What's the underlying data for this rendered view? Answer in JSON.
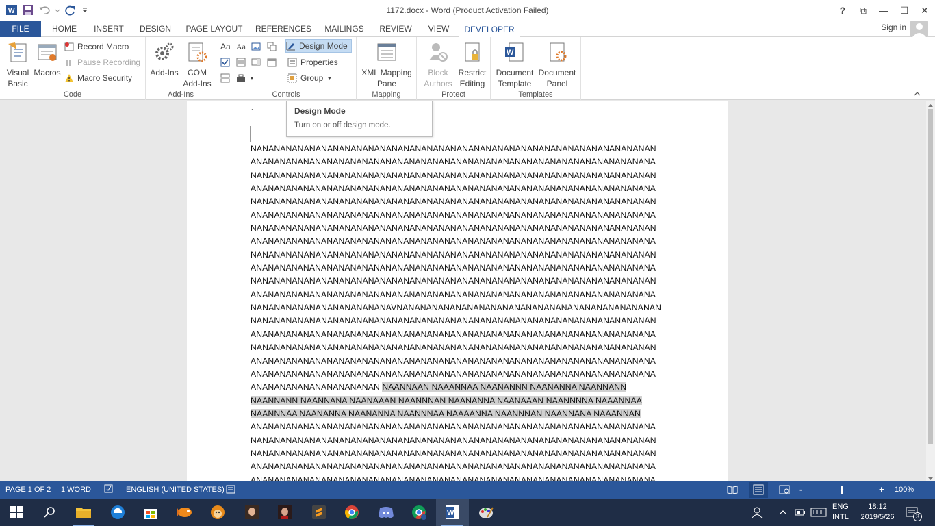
{
  "titlebar": {
    "title": "1172.docx - Word (Product Activation Failed)",
    "help": "?",
    "ribbon_display": "⧉",
    "minimize": "—",
    "maximize": "☐",
    "close": "✕"
  },
  "tabs": [
    "FILE",
    "HOME",
    "INSERT",
    "DESIGN",
    "PAGE LAYOUT",
    "REFERENCES",
    "MAILINGS",
    "REVIEW",
    "VIEW",
    "DEVELOPER"
  ],
  "active_tab": "DEVELOPER",
  "signin": "Sign in",
  "ribbon": {
    "code": {
      "label": "Code",
      "visual_basic": [
        "Visual",
        "Basic"
      ],
      "macros": "Macros",
      "record_macro": "Record Macro",
      "pause_recording": "Pause Recording",
      "macro_security": "Macro Security"
    },
    "addins": {
      "label": "Add-Ins",
      "addins": "Add-Ins",
      "com_addins": [
        "COM",
        "Add-Ins"
      ]
    },
    "controls": {
      "label": "Controls",
      "design_mode": "Design Mode",
      "properties": "Properties",
      "group": "Group",
      "aa1": "Aa",
      "aa2": "Aa"
    },
    "mapping": {
      "label": "Mapping",
      "xml_mapping": [
        "XML Mapping",
        "Pane"
      ]
    },
    "protect": {
      "label": "Protect",
      "block_authors": [
        "Block",
        "Authors"
      ],
      "restrict_editing": [
        "Restrict",
        "Editing"
      ]
    },
    "templates": {
      "label": "Templates",
      "document_template": [
        "Document",
        "Template"
      ],
      "document_panel": [
        "Document",
        "Panel"
      ]
    }
  },
  "tooltip": {
    "title": "Design Mode",
    "description": "Turn on or off design mode."
  },
  "document": {
    "stray_mark": "`",
    "lines": [
      {
        "text": "NANANANANANANANANANANANANANANANANANANANANANANANANANANANANANANANANANAN",
        "highlight": ""
      },
      {
        "text": "ANANANANANANANANANANANANANANANANANANANANANANANANANANANANANANANANANANA",
        "highlight": ""
      },
      {
        "text": "NANANANANANANANANANANANANANANANANANANANANANANANANANANANANANANANANANAN",
        "highlight": ""
      },
      {
        "text": "ANANANANANANANANANANANANANANANANANANANANANANANANANANANANANANANANANANA",
        "highlight": ""
      },
      {
        "text": "NANANANANANANANANANANANANANANANANANANANANANANANANANANANANANANANANANAN",
        "highlight": ""
      },
      {
        "text": "ANANANANANANANANANANANANANANANANANANANANANANANANANANANANANANANANANANA",
        "highlight": ""
      },
      {
        "text": "NANANANANANANANANANANANANANANANANANANANANANANANANANANANANANANANANANAN",
        "highlight": ""
      },
      {
        "text": "ANANANANANANANANANANANANANANANANANANANANANANANANANANANANANANANANANANA",
        "highlight": ""
      },
      {
        "text": "NANANANANANANANANANANANANANANANANANANANANANANANANANANANANANANANANANAN",
        "highlight": ""
      },
      {
        "text": "ANANANANANANANANANANANANANANANANANANANANANANANANANANANANANANANANANANA",
        "highlight": ""
      },
      {
        "text": "NANANANANANANANANANANANANANANANANANANANANANANANANANANANANANANANANANAN",
        "highlight": ""
      },
      {
        "text": "ANANANANANANANANANANANANANANANANANANANANANANANANANANANANANANANANANANA",
        "highlight": ""
      },
      {
        "text": "NANANANANANANANANANANANAVNANANANANANANANANANANANANANANANANANANANANANAN",
        "highlight": ""
      },
      {
        "text": "NANANANANANANANANANANANANANANANANANANANANANANANANANANANANANANANANANAN",
        "highlight": ""
      },
      {
        "text": "ANANANANANANANANANANANANANANANANANANANANANANANANANANANANANANANANANANA",
        "highlight": ""
      },
      {
        "text": "NANANANANANANANANANANANANANANANANANANANANANANANANANANANANANANANANANAN",
        "highlight": ""
      },
      {
        "text": "ANANANANANANANANANANANANANANANANANANANANANANANANANANANANANANANANANANA",
        "highlight": ""
      },
      {
        "text": "ANANANANANANANANANANANANANANANANANANANANANANANANANANANANANANANANANANA",
        "highlight": ""
      },
      {
        "text": "ANANANANANANANANANANAN ",
        "highlight": "NAANNAAN NAAANNAA NAANANNN NAANANNA NAANNANN"
      },
      {
        "text": "",
        "highlight": "NAANNANN NAANNANA NAANAAAN NAANNNAN NAANANNA NAANAAAN NAANNNNA NAAANNAA"
      },
      {
        "text": "",
        "highlight": "NAANNNAA NAANANNA NAANANNA NAANNNAA NAAAANNA NAANNNAN NAANNANA NAAANNAN"
      },
      {
        "text": "ANANANANANANANANANANANANANANANANANANANANANANANANANANANANANANANANANANA",
        "highlight": ""
      },
      {
        "text": "NANANANANANANANANANANANANANANANANANANANANANANANANANANANANANANANANANAN",
        "highlight": ""
      },
      {
        "text": "NANANANANANANANANANANANANANANANANANANANANANANANANANANANANANANANANANAN",
        "highlight": ""
      },
      {
        "text": "ANANANANANANANANANANANANANANANANANANANANANANANANANANANANANANANANANANA",
        "highlight": ""
      },
      {
        "text": "ANANANANANANANANANANANANANANANANANANANANANANANANANANANANANANANANANANA",
        "highlight": ""
      }
    ]
  },
  "statusbar": {
    "page": "PAGE 1 OF 2",
    "words": "1 WORD",
    "language": "ENGLISH (UNITED STATES)",
    "zoom_minus": "-",
    "zoom_plus": "+",
    "zoom_value": "100%",
    "zoom_level_percent": 100
  },
  "taskbar": {
    "lang_top": "ENG",
    "lang_bottom": "INTL",
    "time": "18:12",
    "date": "2019/5/26",
    "notifications": "3"
  },
  "colors": {
    "word_blue": "#2b579a",
    "highlight_gray": "#d0d0d0",
    "taskbar": "#1f2d46"
  }
}
